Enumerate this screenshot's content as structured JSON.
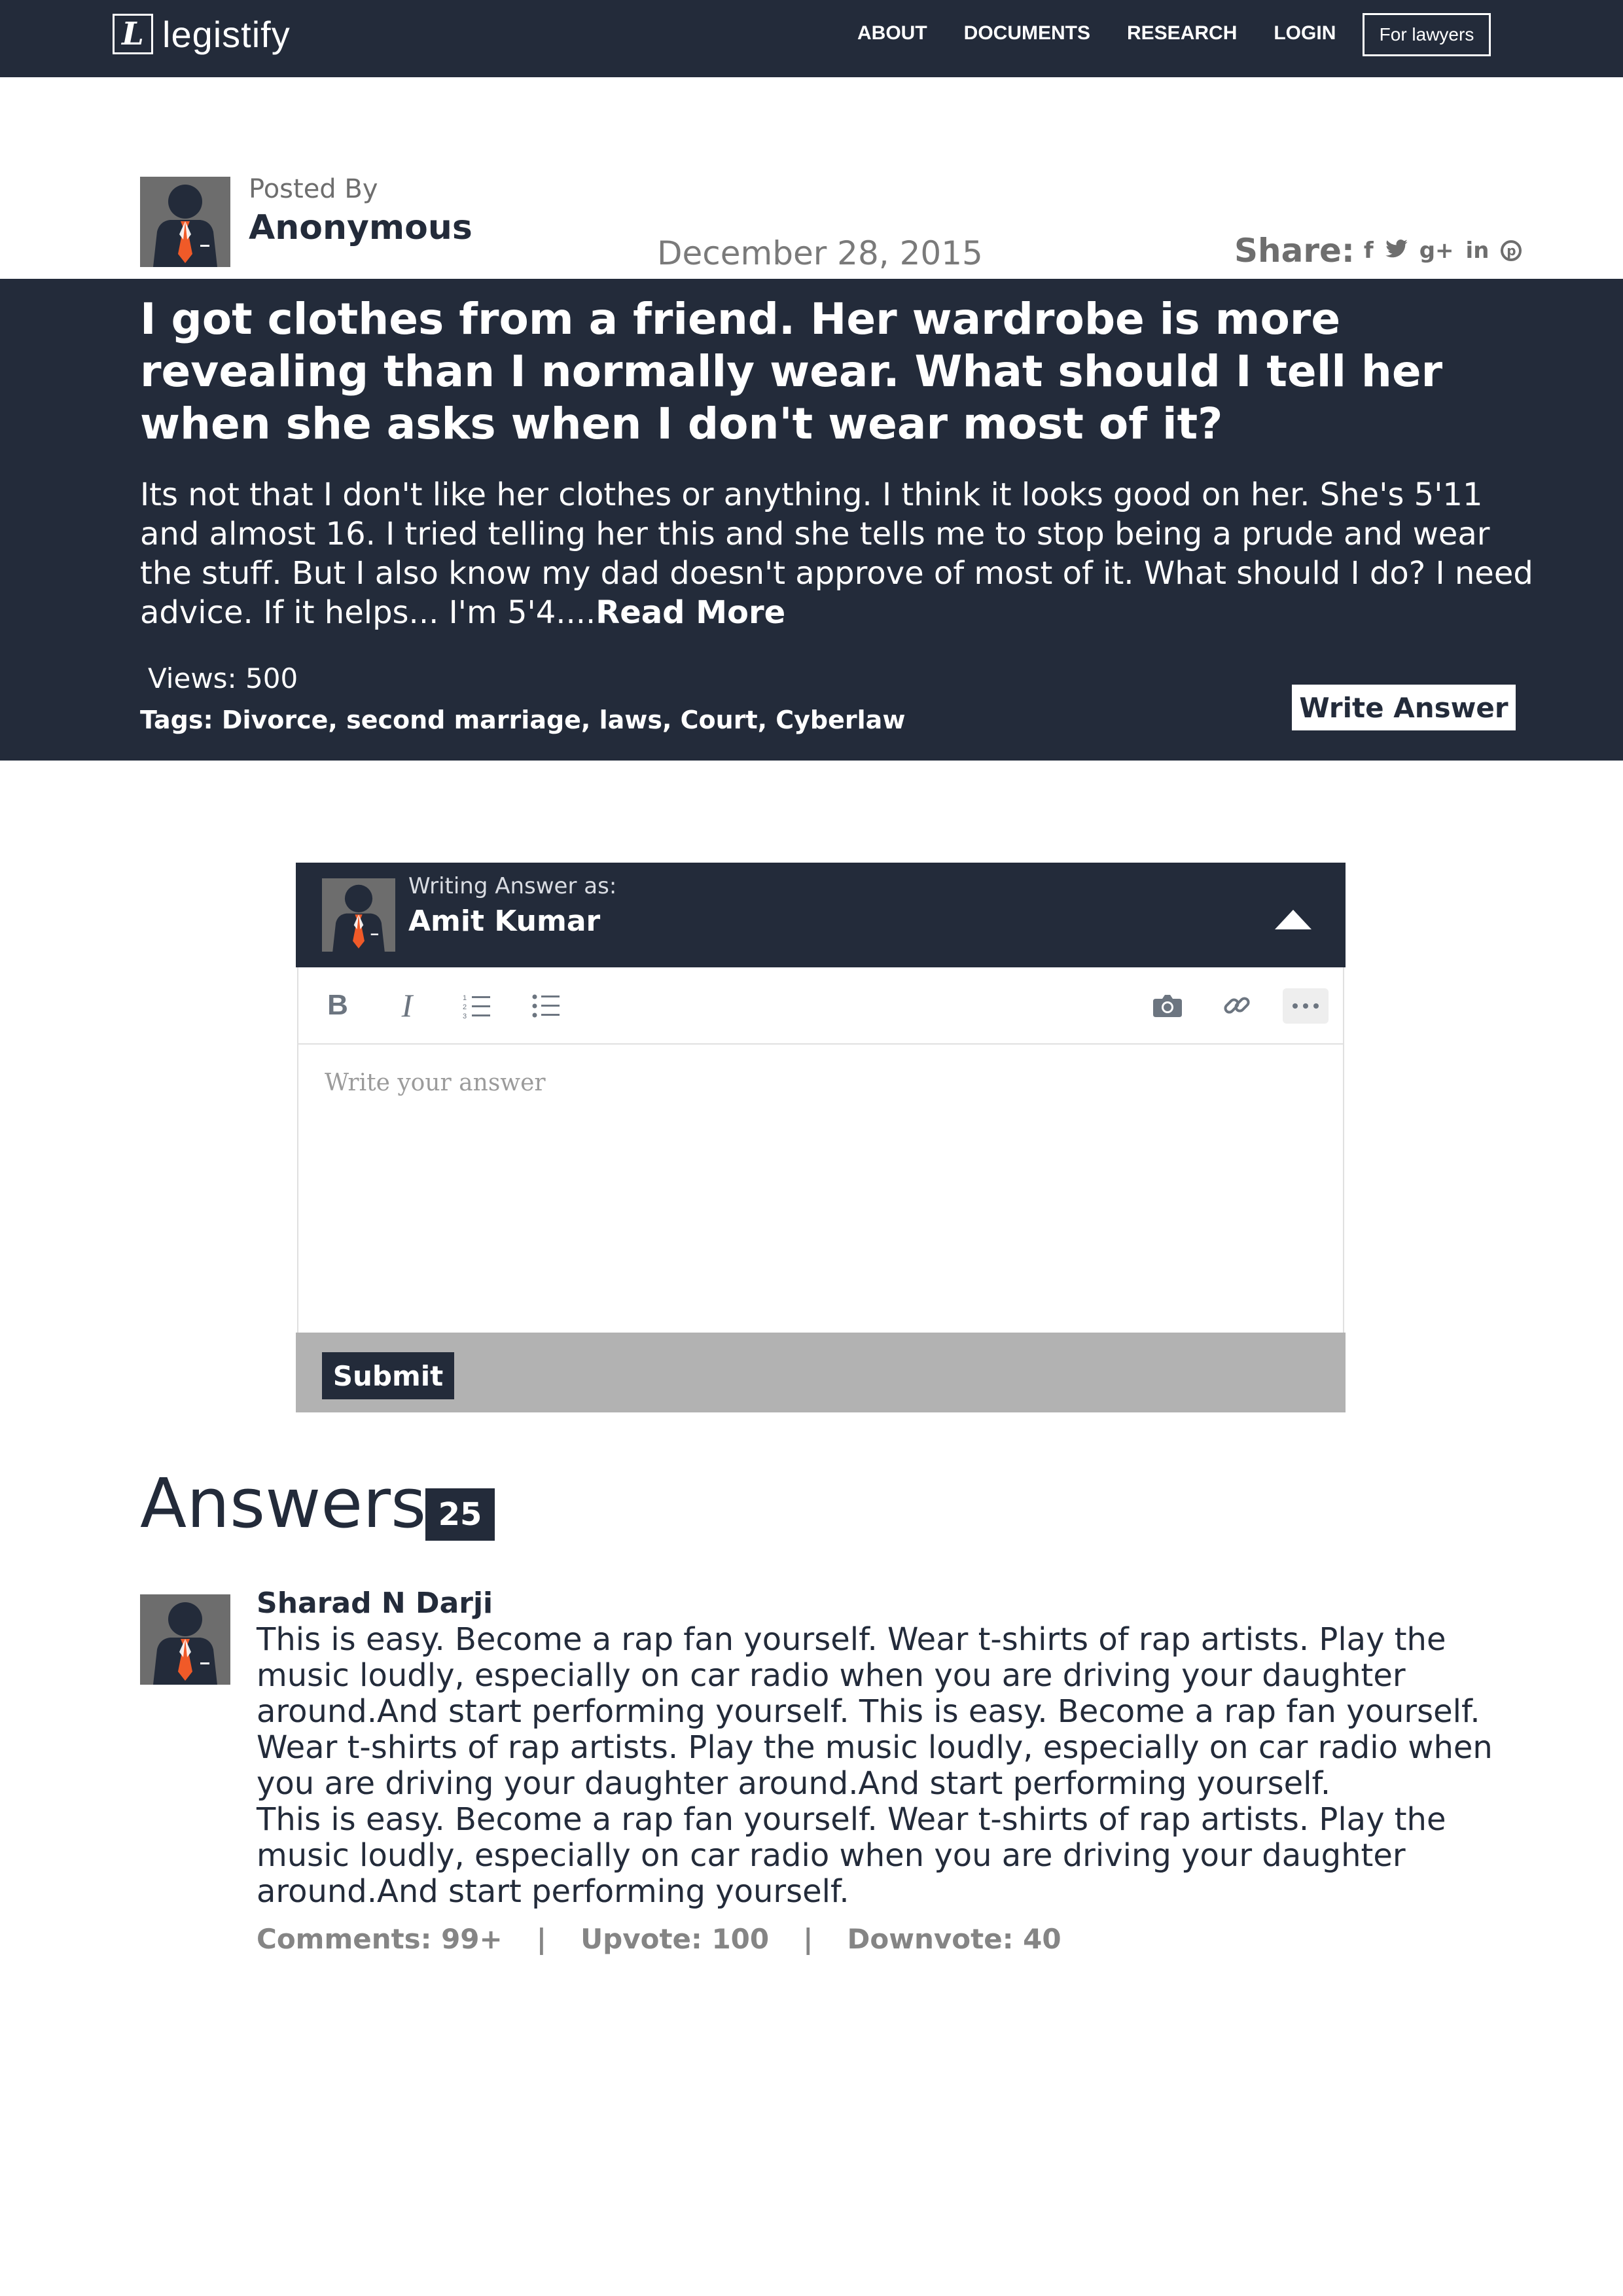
{
  "nav": {
    "brand_mark": "L",
    "brand_name": "legistify",
    "links": [
      "ABOUT",
      "DOCUMENTS",
      "RESEARCH",
      "LOGIN"
    ],
    "cta": "For lawyers"
  },
  "question": {
    "posted_by_label": "Posted By",
    "author": "Anonymous",
    "date": "December 28, 2015",
    "share_label": "Share:",
    "share_icons": [
      "facebook-icon",
      "twitter-icon",
      "google-plus-icon",
      "linkedin-icon",
      "pinterest-icon"
    ],
    "share_glyphs": {
      "facebook": "f",
      "twitter": "🐦",
      "google_plus": "g+",
      "linkedin": "in",
      "pinterest": "p"
    },
    "title": "I got clothes from a friend. Her wardrobe is more revealing than I normally wear. What should I tell her when she asks when I don't wear most of it?",
    "body": "Its not that I don't like her clothes or anything. I think it looks good on her. She's 5'11 and almost 16. I tried telling her this and she tells me to stop being a prude and wear the stuff. But I also know my dad doesn't approve of most of it. What should I do? I need advice. If it helps... I'm 5'4....",
    "read_more": "Read More",
    "views": "Views: 500",
    "tags_label": "Tags:",
    "tags": "Divorce, second marriage, laws, Court, Cyberlaw",
    "write_answer": "Write Answer"
  },
  "editor": {
    "writing_as_label": "Writing Answer as:",
    "writer": "Amit Kumar",
    "placeholder": "Write your answer",
    "toolbar": [
      "bold-icon",
      "italic-icon",
      "ordered-list-icon",
      "bullet-list-icon",
      "camera-icon",
      "link-icon",
      "more-icon"
    ],
    "submit": "Submit"
  },
  "answers": {
    "title": "Answers",
    "count": "25",
    "items": [
      {
        "author": "Sharad N Darji",
        "paragraphs": [
          "This is easy. Become a rap fan yourself. Wear t-shirts of rap artists. Play the music loudly, especially on car radio when you are driving your daughter around.And start performing yourself. This is easy. Become a rap fan yourself. Wear t-shirts of rap artists. Play the music loudly, especially on car radio when you are driving your daughter around.And start performing yourself.",
          "This is easy. Become a rap fan yourself. Wear t-shirts of rap artists. Play the music loudly, especially on car radio when you are driving your daughter around.And start performing yourself."
        ],
        "comments": "Comments: 99+",
        "upvotes": "Upvote: 100",
        "downvotes": "Downvote: 40",
        "separator": "|"
      }
    ]
  },
  "colors": {
    "navy": "#232b3a",
    "gray_text": "#6e6e6e",
    "footer_gray": "#b2b2b2",
    "avatar_bg": "#6d6d6d",
    "tie_orange": "#f05a28"
  }
}
